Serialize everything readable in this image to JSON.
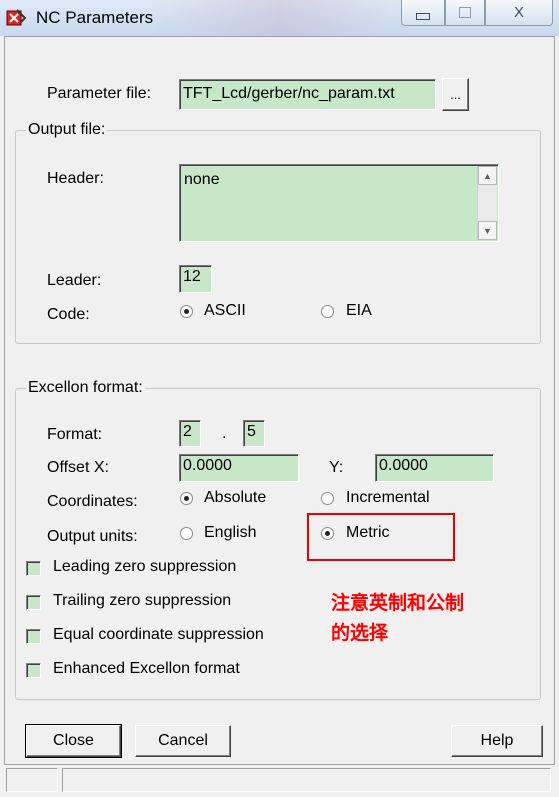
{
  "window": {
    "title": "NC Parameters",
    "caption_buttons": {
      "minimize": "—",
      "maximize": "□",
      "close": "X"
    }
  },
  "parameter_file": {
    "label": "Parameter file:",
    "value": "TFT_Lcd/gerber/nc_param.txt",
    "browse_label": "..."
  },
  "output_file": {
    "group_title": "Output file:",
    "header_label": "Header:",
    "header_value": "none",
    "leader_label": "Leader:",
    "leader_value": "12",
    "code_label": "Code:",
    "code_options": [
      {
        "label": "ASCII",
        "selected": true
      },
      {
        "label": "EIA",
        "selected": false
      }
    ]
  },
  "excellon": {
    "group_title": "Excellon format:",
    "format_label": "Format:",
    "format_int": "2",
    "format_sep": ".",
    "format_dec": "5",
    "offset_x_label": "Offset X:",
    "offset_x_value": "0.0000",
    "offset_y_label": "Y:",
    "offset_y_value": "0.0000",
    "coordinates_label": "Coordinates:",
    "coordinates_options": [
      {
        "label": "Absolute",
        "selected": true
      },
      {
        "label": "Incremental",
        "selected": false
      }
    ],
    "units_label": "Output units:",
    "units_options": [
      {
        "label": "English",
        "selected": false
      },
      {
        "label": "Metric",
        "selected": true
      }
    ]
  },
  "checkboxes": [
    {
      "label": "Leading zero suppression",
      "checked": false
    },
    {
      "label": "Trailing zero suppression",
      "checked": false
    },
    {
      "label": "Equal coordinate suppression",
      "checked": false
    },
    {
      "label": "Enhanced Excellon format",
      "checked": false
    }
  ],
  "annotation": {
    "line1": "注意英制和公制",
    "line2": "的选择",
    "color": "#ff0000"
  },
  "buttons": {
    "close": "Close",
    "cancel": "Cancel",
    "help": "Help"
  },
  "colors": {
    "field_bg": "#c8e6c8",
    "highlight": "#e60000"
  }
}
